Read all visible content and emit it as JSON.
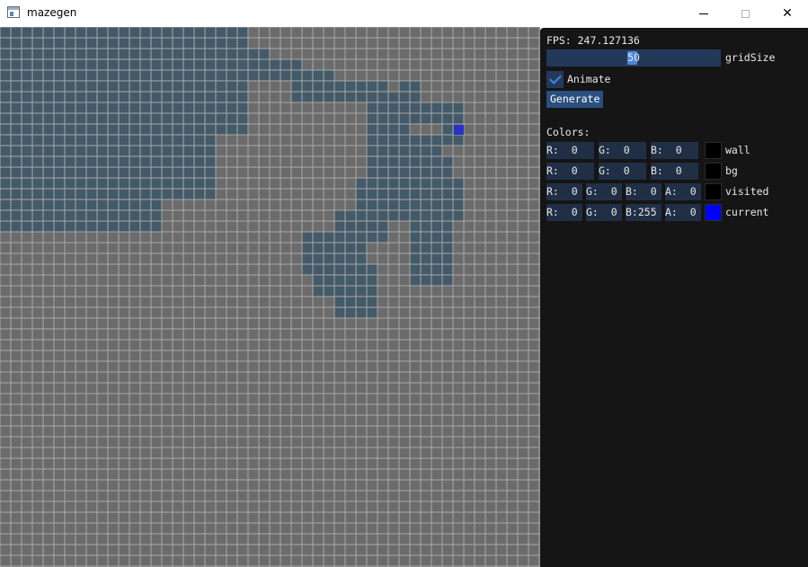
{
  "window": {
    "title": "mazegen",
    "icon": "app-window-icon",
    "controls": {
      "minimize": "—",
      "maximize": "□",
      "close": "✕"
    }
  },
  "maze": {
    "grid_size": 50,
    "colors": {
      "background": "#6b6b6b",
      "grid_line": "#a8a8a8",
      "visited": "#435a68",
      "current": "#2832c8"
    }
  },
  "panel": {
    "fps_text": "FPS: 247.127136",
    "slider": {
      "value": "50",
      "label": "gridSize"
    },
    "animate": {
      "label": "Animate",
      "checked": true
    },
    "generate_label": "Generate",
    "colors_heading": "Colors:",
    "rows": [
      {
        "label": "wall",
        "swatch": "#000000",
        "fields": [
          {
            "text": "R:  0"
          },
          {
            "text": "G:  0"
          },
          {
            "text": "B:  0"
          }
        ]
      },
      {
        "label": "bg",
        "swatch": "#000000",
        "fields": [
          {
            "text": "R:  0"
          },
          {
            "text": "G:  0"
          },
          {
            "text": "B:  0"
          }
        ]
      },
      {
        "label": "visited",
        "swatch": "#000000",
        "fields": [
          {
            "text": "R:  0"
          },
          {
            "text": "G:  0"
          },
          {
            "text": "B:  0"
          },
          {
            "text": "A:  0"
          }
        ]
      },
      {
        "label": "current",
        "swatch": "#0000ff",
        "fields": [
          {
            "text": "R:  0"
          },
          {
            "text": "G:  0"
          },
          {
            "text": "B:255"
          },
          {
            "text": "A:  0"
          }
        ]
      }
    ]
  }
}
